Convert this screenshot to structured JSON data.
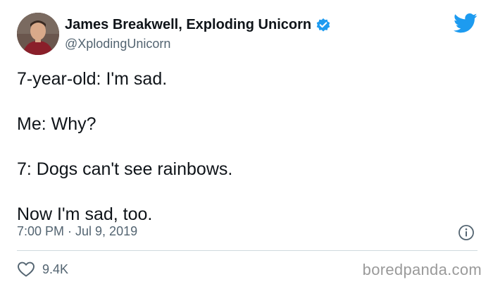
{
  "author": {
    "display_name": "James Breakwell, Exploding Unicorn",
    "handle": "@XplodingUnicorn",
    "avatar_icon": "profile-photo",
    "verified_icon": "verified-badge-icon"
  },
  "tweet": {
    "lines": [
      "7-year-old: I'm sad.",
      "Me: Why?",
      "7: Dogs can't see rainbows.",
      "Now I'm sad, too."
    ],
    "timestamp": "7:00 PM · Jul 9, 2019"
  },
  "actions": {
    "like_icon": "heart-icon",
    "like_count": "9.4K",
    "info_icon": "info-icon"
  },
  "brand": {
    "platform_icon": "twitter-bird-icon",
    "watermark": "boredpanda.com"
  },
  "colors": {
    "twitter_blue": "#1d9bf0",
    "text_primary": "#0f1419",
    "text_secondary": "#536471",
    "divider": "#cfd9de",
    "watermark": "#9a9a9a"
  }
}
